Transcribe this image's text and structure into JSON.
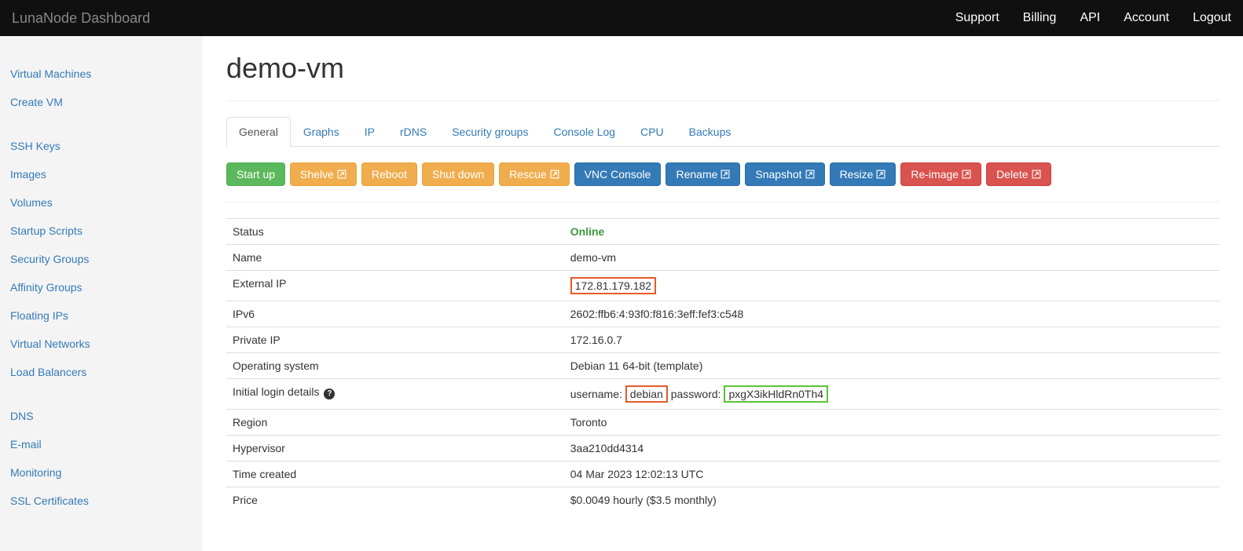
{
  "navbar": {
    "brand": "LunaNode Dashboard",
    "links": [
      "Support",
      "Billing",
      "API",
      "Account",
      "Logout"
    ]
  },
  "sidebar": {
    "group1": [
      "Virtual Machines",
      "Create VM"
    ],
    "group2": [
      "SSH Keys",
      "Images",
      "Volumes",
      "Startup Scripts",
      "Security Groups",
      "Affinity Groups",
      "Floating IPs",
      "Virtual Networks",
      "Load Balancers"
    ],
    "group3": [
      "DNS",
      "E-mail",
      "Monitoring",
      "SSL Certificates"
    ]
  },
  "page": {
    "title": "demo-vm"
  },
  "tabs": [
    "General",
    "Graphs",
    "IP",
    "rDNS",
    "Security groups",
    "Console Log",
    "CPU",
    "Backups"
  ],
  "activeTab": "General",
  "actions": [
    {
      "label": "Start up",
      "style": "success",
      "ext": false
    },
    {
      "label": "Shelve",
      "style": "warning",
      "ext": true
    },
    {
      "label": "Reboot",
      "style": "warning",
      "ext": false
    },
    {
      "label": "Shut down",
      "style": "warning",
      "ext": false
    },
    {
      "label": "Rescue",
      "style": "warning",
      "ext": true
    },
    {
      "label": "VNC Console",
      "style": "primary",
      "ext": false
    },
    {
      "label": "Rename",
      "style": "primary",
      "ext": true
    },
    {
      "label": "Snapshot",
      "style": "primary",
      "ext": true
    },
    {
      "label": "Resize",
      "style": "primary",
      "ext": true
    },
    {
      "label": "Re-image",
      "style": "danger",
      "ext": true
    },
    {
      "label": "Delete",
      "style": "danger",
      "ext": true
    }
  ],
  "details": {
    "status_label": "Status",
    "status_value": "Online",
    "name_label": "Name",
    "name_value": "demo-vm",
    "extip_label": "External IP",
    "extip_value": "172.81.179.182",
    "ipv6_label": "IPv6",
    "ipv6_value": "2602:ffb6:4:93f0:f816:3eff:fef3:c548",
    "privip_label": "Private IP",
    "privip_value": "172.16.0.7",
    "os_label": "Operating system",
    "os_value": "Debian 11 64-bit (template)",
    "login_label": "Initial login details",
    "login_user_prefix": "username:",
    "login_user": "debian",
    "login_pass_prefix": "password:",
    "login_pass": "pxgX3ikHldRn0Th4",
    "region_label": "Region",
    "region_value": "Toronto",
    "hyp_label": "Hypervisor",
    "hyp_value": "3aa210dd4314",
    "created_label": "Time created",
    "created_value": "04 Mar 2023 12:02:13 UTC",
    "price_label": "Price",
    "price_value": "$0.0049 hourly ($3.5 monthly)"
  }
}
